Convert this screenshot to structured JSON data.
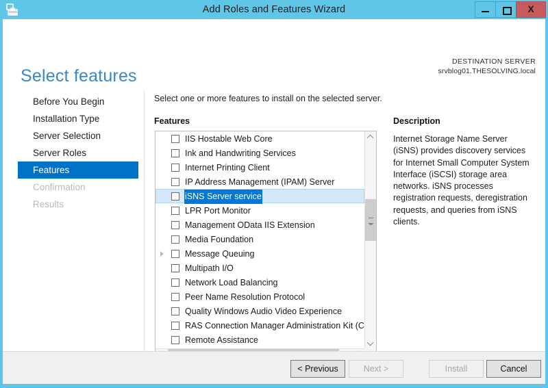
{
  "window": {
    "title": "Add Roles and Features Wizard",
    "icon": "server-manager-icon",
    "minimize_label": "–",
    "maximize_label": "□",
    "close_label": "X",
    "titlebar_color": "#5fc6e8",
    "close_color": "#c75b5b"
  },
  "header": {
    "page_title": "Select features",
    "destination_label": "DESTINATION SERVER",
    "destination_server": "srvblog01.THESOLVING.local",
    "title_color": "#3a87c4"
  },
  "sidebar": {
    "accent_color": "#0072c6",
    "items": [
      {
        "label": "Before You Begin",
        "state": "normal"
      },
      {
        "label": "Installation Type",
        "state": "normal"
      },
      {
        "label": "Server Selection",
        "state": "normal"
      },
      {
        "label": "Server Roles",
        "state": "normal"
      },
      {
        "label": "Features",
        "state": "active"
      },
      {
        "label": "Confirmation",
        "state": "disabled"
      },
      {
        "label": "Results",
        "state": "disabled"
      }
    ]
  },
  "main": {
    "intro_text": "Select one or more features to install on the selected server.",
    "features_label": "Features",
    "selection_fill": "#d4e8f9",
    "selection_text_fill": "#0078d7",
    "features": [
      {
        "label": "IIS Hostable Web Core",
        "checked": false,
        "expandable": false,
        "selected": false
      },
      {
        "label": "Ink and Handwriting Services",
        "checked": false,
        "expandable": false,
        "selected": false
      },
      {
        "label": "Internet Printing Client",
        "checked": false,
        "expandable": false,
        "selected": false
      },
      {
        "label": "IP Address Management (IPAM) Server",
        "checked": false,
        "expandable": false,
        "selected": false
      },
      {
        "label": "iSNS Server service",
        "checked": false,
        "expandable": false,
        "selected": true
      },
      {
        "label": "LPR Port Monitor",
        "checked": false,
        "expandable": false,
        "selected": false
      },
      {
        "label": "Management OData IIS Extension",
        "checked": false,
        "expandable": false,
        "selected": false
      },
      {
        "label": "Media Foundation",
        "checked": false,
        "expandable": false,
        "selected": false
      },
      {
        "label": "Message Queuing",
        "checked": false,
        "expandable": true,
        "selected": false
      },
      {
        "label": "Multipath I/O",
        "checked": false,
        "expandable": false,
        "selected": false
      },
      {
        "label": "Network Load Balancing",
        "checked": false,
        "expandable": false,
        "selected": false
      },
      {
        "label": "Peer Name Resolution Protocol",
        "checked": false,
        "expandable": false,
        "selected": false
      },
      {
        "label": "Quality Windows Audio Video Experience",
        "checked": false,
        "expandable": false,
        "selected": false
      },
      {
        "label": "RAS Connection Manager Administration Kit (CMAK)",
        "checked": false,
        "expandable": false,
        "selected": false
      },
      {
        "label": "Remote Assistance",
        "checked": false,
        "expandable": false,
        "selected": false
      }
    ]
  },
  "description": {
    "label": "Description",
    "body": "Internet Storage Name Server (iSNS) provides discovery services for Internet Small Computer System Interface (iSCSI) storage area networks. iSNS processes registration requests, deregistration requests, and queries from iSNS clients."
  },
  "footer": {
    "previous_label": "< Previous",
    "next_label": "Next >",
    "install_label": "Install",
    "cancel_label": "Cancel",
    "next_enabled": false,
    "install_enabled": false
  }
}
